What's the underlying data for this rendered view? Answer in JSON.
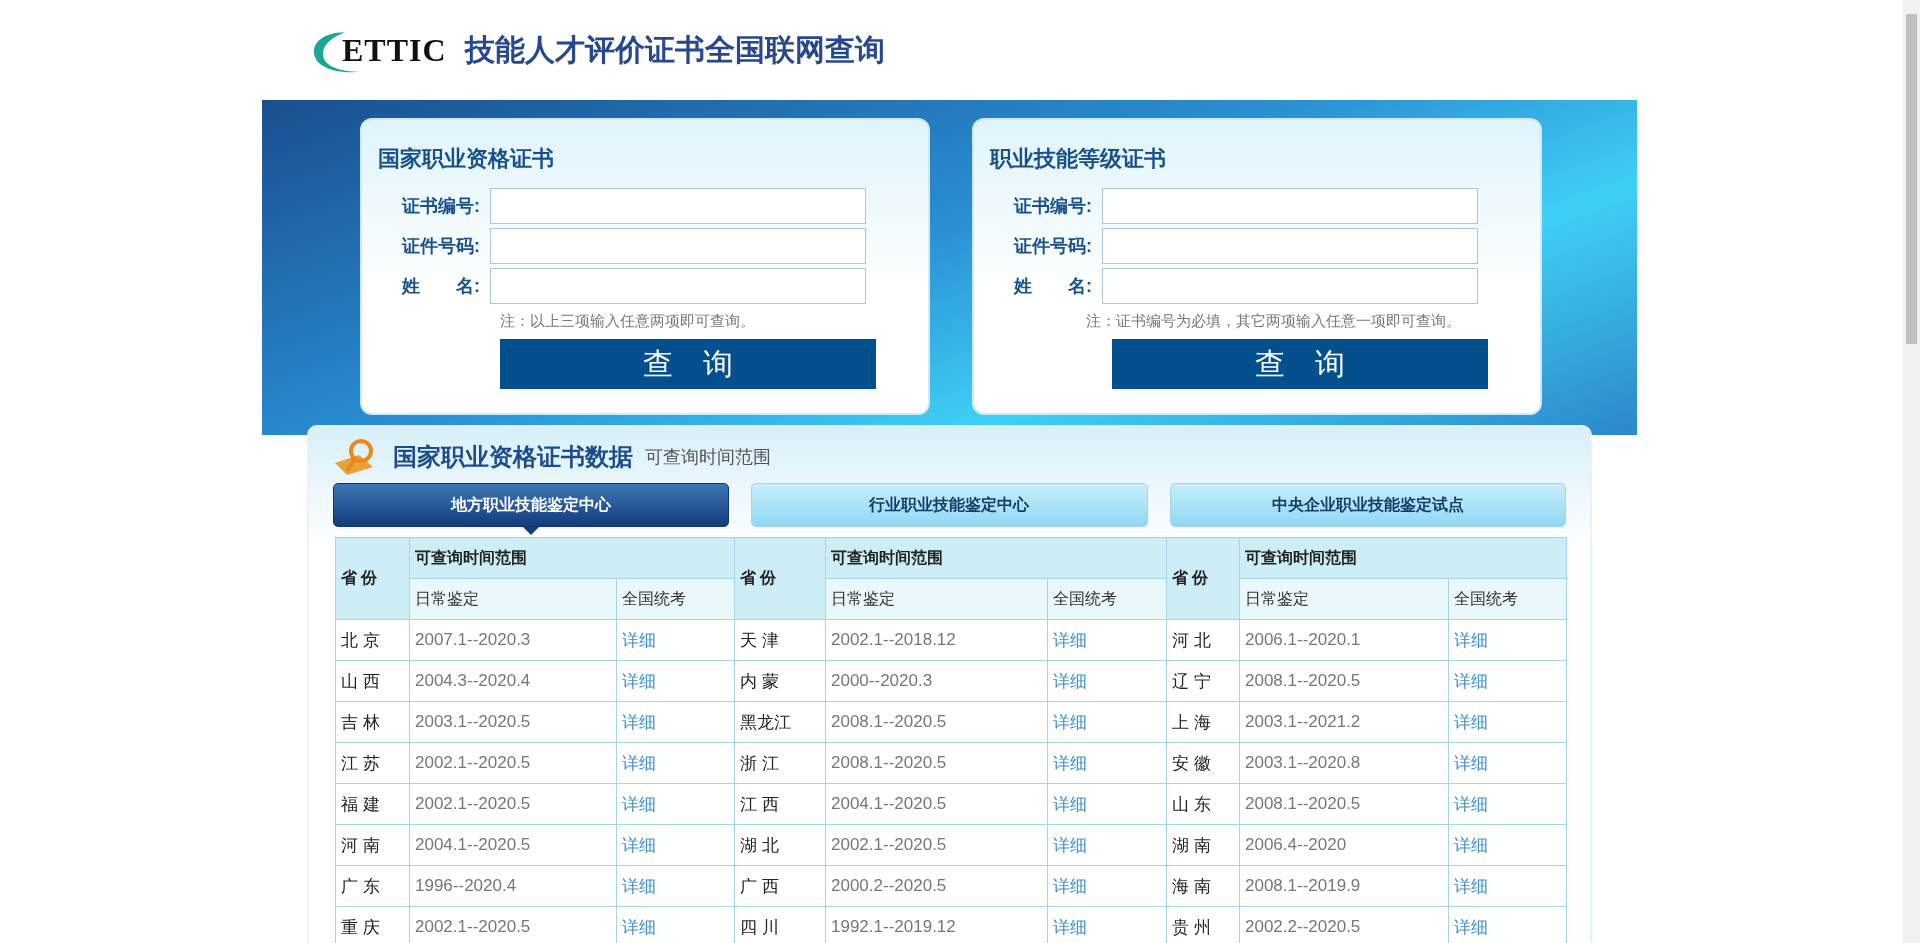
{
  "header": {
    "logo_text": "ETTIC",
    "title": "技能人才评价证书全国联网查询"
  },
  "forms": [
    {
      "title": "国家职业资格证书",
      "fields": [
        {
          "label": "证书编号:"
        },
        {
          "label": "证件号码:"
        },
        {
          "label": "姓　　名:"
        }
      ],
      "note": "注：以上三项输入任意两项即可查询。",
      "button": "查　询"
    },
    {
      "title": "职业技能等级证书",
      "fields": [
        {
          "label": "证书编号:"
        },
        {
          "label": "证件号码:"
        },
        {
          "label": "姓　　名:"
        }
      ],
      "note": "注：证书编号为必填，其它两项输入任意一项即可查询。",
      "button": "查　询"
    }
  ],
  "data_panel": {
    "title": "国家职业资格证书数据",
    "subtitle": "可查询时间范围",
    "tabs": [
      {
        "label": "地方职业技能鉴定中心",
        "selected": true
      },
      {
        "label": "行业职业技能鉴定中心",
        "selected": false
      },
      {
        "label": "中央企业职业技能鉴定试点",
        "selected": false
      }
    ],
    "table": {
      "groups": [
        {
          "province": "省 份",
          "range": "可查询时间范围",
          "daily": "日常鉴定",
          "exam": "全国统考"
        },
        {
          "province": "省 份",
          "range": "可查询时间范围",
          "daily": "日常鉴定",
          "exam": "全国统考"
        },
        {
          "province": "省 份",
          "range": "可查询时间范围",
          "daily": "日常鉴定",
          "exam": "全国统考"
        }
      ],
      "rows": [
        [
          {
            "province": "北 京",
            "range": "2007.1--2020.3",
            "link": "详细"
          },
          {
            "province": "天 津",
            "range": "2002.1--2018.12",
            "link": "详细"
          },
          {
            "province": "河 北",
            "range": "2006.1--2020.1",
            "link": "详细"
          }
        ],
        [
          {
            "province": "山 西",
            "range": "2004.3--2020.4",
            "link": "详细"
          },
          {
            "province": "内 蒙",
            "range": "2000--2020.3",
            "link": "详细"
          },
          {
            "province": "辽 宁",
            "range": "2008.1--2020.5",
            "link": "详细"
          }
        ],
        [
          {
            "province": "吉 林",
            "range": "2003.1--2020.5",
            "link": "详细"
          },
          {
            "province": "黑龙江",
            "range": "2008.1--2020.5",
            "link": "详细"
          },
          {
            "province": "上 海",
            "range": "2003.1--2021.2",
            "link": "详细"
          }
        ],
        [
          {
            "province": "江 苏",
            "range": "2002.1--2020.5",
            "link": "详细"
          },
          {
            "province": "浙 江",
            "range": "2008.1--2020.5",
            "link": "详细"
          },
          {
            "province": "安 徽",
            "range": "2003.1--2020.8",
            "link": "详细"
          }
        ],
        [
          {
            "province": "福 建",
            "range": "2002.1--2020.5",
            "link": "详细"
          },
          {
            "province": "江 西",
            "range": "2004.1--2020.5",
            "link": "详细"
          },
          {
            "province": "山 东",
            "range": "2008.1--2020.5",
            "link": "详细"
          }
        ],
        [
          {
            "province": "河 南",
            "range": "2004.1--2020.5",
            "link": "详细"
          },
          {
            "province": "湖 北",
            "range": "2002.1--2020.5",
            "link": "详细"
          },
          {
            "province": "湖 南",
            "range": "2006.4--2020",
            "link": "详细"
          }
        ],
        [
          {
            "province": "广 东",
            "range": "1996--2020.4",
            "link": "详细"
          },
          {
            "province": "广 西",
            "range": "2000.2--2020.5",
            "link": "详细"
          },
          {
            "province": "海 南",
            "range": "2008.1--2019.9",
            "link": "详细"
          }
        ],
        [
          {
            "province": "重 庆",
            "range": "2002.1--2020.5",
            "link": "详细"
          },
          {
            "province": "四 川",
            "range": "1992.1--2019.12",
            "link": "详细"
          },
          {
            "province": "贵 州",
            "range": "2002.2--2020.5",
            "link": "详细"
          }
        ]
      ]
    }
  }
}
